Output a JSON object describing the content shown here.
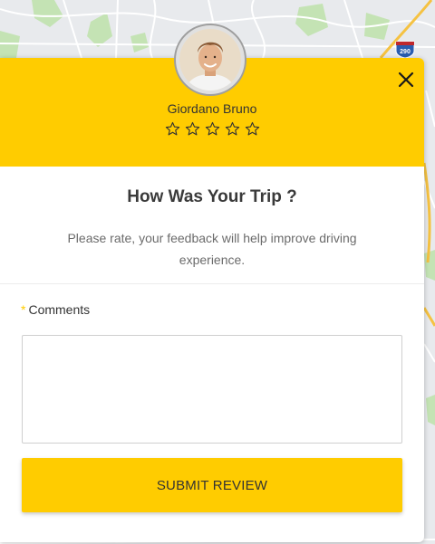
{
  "map": {
    "road_sign": "290",
    "colors": {
      "land": "#e8eaed",
      "park": "#b7dfa8",
      "road": "#ffffff",
      "highway": "#f5c242",
      "water": "#aadaff"
    }
  },
  "modal": {
    "accent_color": "#ffcc00",
    "driver": {
      "name": "Giordano Bruno",
      "avatar": "driver-photo"
    },
    "rating": {
      "max": 5,
      "selected": 0
    },
    "title": "How Was Your Trip ?",
    "subtitle": "Please rate, your feedback will help improve driving experience.",
    "comments": {
      "required_mark": "*",
      "label": "Comments",
      "value": "",
      "placeholder": ""
    },
    "submit_label": "SUBMIT REVIEW",
    "close_icon": "close-icon"
  }
}
